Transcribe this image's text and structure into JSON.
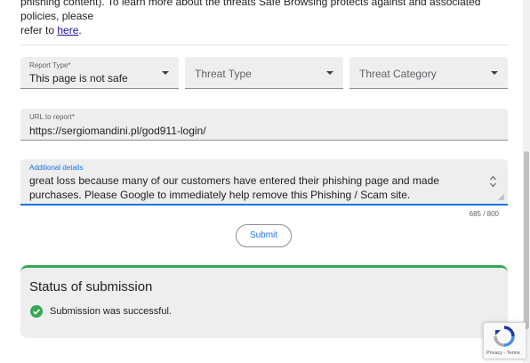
{
  "intro": {
    "line1": "phishing content). To learn more about the threats Safe Browsing protects against and associated policies, please",
    "line2_prefix": "refer to ",
    "link_text": "here",
    "line2_suffix": "."
  },
  "form": {
    "report_type": {
      "label": "Report Type*",
      "value": "This page is not safe"
    },
    "threat_type": {
      "placeholder": "Threat Type"
    },
    "threat_category": {
      "placeholder": "Threat Category"
    },
    "url": {
      "label": "URL to report*",
      "value": "https://sergiomandini.pl/god911-login/"
    },
    "details": {
      "label": "Additional details",
      "value": "great loss because many of our customers have entered their phishing page and made purchases. Please Google to immediately help remove this Phishing / Scam site."
    },
    "counter": "685 / 800",
    "submit_label": "Submit"
  },
  "status": {
    "title": "Status of submission",
    "message": "Submission was successful."
  },
  "recaptcha": {
    "links": "Privacy - Terms"
  },
  "colors": {
    "accent": "#1a73e8",
    "success": "#34a853",
    "field_bg": "#eeeeee"
  }
}
